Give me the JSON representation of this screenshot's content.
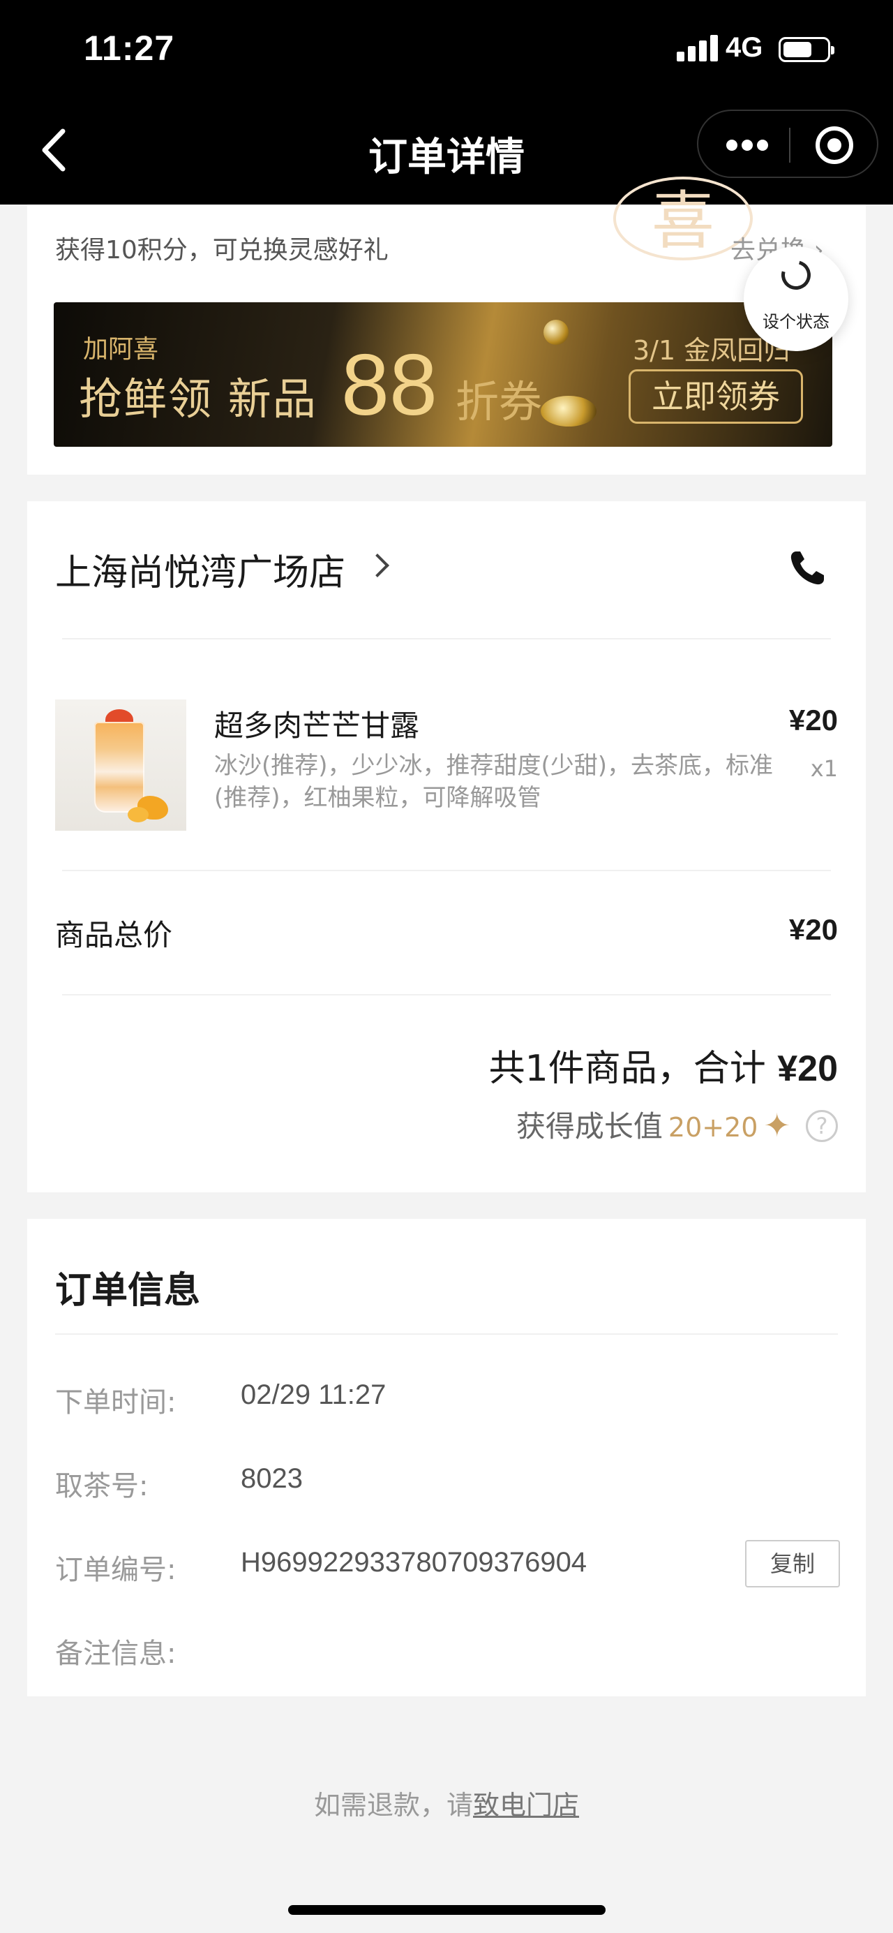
{
  "status_bar": {
    "time": "11:27",
    "network": "4G",
    "battery_level": 0.6
  },
  "nav": {
    "title": "订单详情",
    "back_icon": "chevron-left-icon",
    "more_icon": "more-dots-icon",
    "close_icon": "target-icon"
  },
  "rewards": {
    "points_text": "获得10积分，可兑换灵感好礼",
    "exchange_link": "去兑换",
    "watermark": "喜"
  },
  "status_button": {
    "label": "设个状态"
  },
  "banner": {
    "brand": "加阿喜",
    "headline": "抢鲜领 新品",
    "big_number": "88",
    "suffix": "折券",
    "date_text": "3/1 金凤回归",
    "cta": "立即领券"
  },
  "order": {
    "store_name": "上海尚悦湾广场店",
    "item": {
      "name": "超多肉芒芒甘露",
      "price": "¥20",
      "options": "冰沙(推荐)，少少冰，推荐甜度(少甜)，去茶底，标准(推荐)，红柚果粒，可降解吸管",
      "quantity": "x1"
    },
    "subtotal_label": "商品总价",
    "subtotal_value": "¥20",
    "total_prefix": "共1件商品，合计",
    "total_amount": "¥20",
    "growth_label": "获得成长值",
    "growth_value": "20+20",
    "growth_star": "✦",
    "help_icon": "?"
  },
  "order_info": {
    "title": "订单信息",
    "rows": [
      {
        "label": "下单时间:",
        "value": "02/29 11:27"
      },
      {
        "label": "取茶号:",
        "value": "8023"
      },
      {
        "label": "订单编号:",
        "value": "H969922933780709376904"
      },
      {
        "label": "备注信息:",
        "value": ""
      }
    ],
    "copy_button": "复制"
  },
  "footer": {
    "refund_prefix": "如需退款，请",
    "refund_link": "致电门店"
  },
  "colors": {
    "accent_gold": "#c9a064",
    "nav_bg": "#000000",
    "page_bg": "#f3f3f3"
  }
}
